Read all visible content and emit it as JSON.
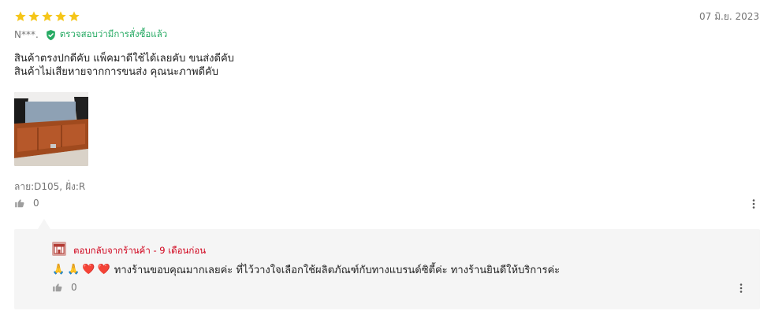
{
  "review": {
    "rating": 5,
    "date": "07 มิ.ย. 2023",
    "user": "N***.",
    "verified_label": "ตรวจสอบว่ามีการสั่งซื้อแล้ว",
    "text_lines": [
      "สินค้าตรงปกดีคับ แพ็คมาดีใช้ได้เลยคับ ขนส่งดีคับ",
      "สินค้าไม่เสียหายจากการขนส่ง คุณนะภาพดีคับ"
    ],
    "variant": "ลาย:D105, ฝั่ง:R",
    "likes": "0"
  },
  "reply": {
    "label": "ตอบกลับจากร้านค้า - 9 เดือนก่อน",
    "emojis": [
      "🙏",
      "🙏",
      "❤️",
      "❤️"
    ],
    "text": "ทางร้านขอบคุณมากเลยค่ะ ที่ไว้วางใจเลือกใช้ผลิตภัณฑ์กับทางแบรนด์ซิตี้ค่ะ ทางร้านยินดีให้บริการค่ะ",
    "likes": "0"
  },
  "colors": {
    "star": "#f5c518",
    "verified": "#26aa63",
    "reply_label": "#d0021b",
    "reply_bg": "#f5f5f5"
  },
  "icons": {
    "star": "star-icon",
    "verified": "check-shield-icon",
    "like": "thumbs-up-icon",
    "more": "more-vertical-icon",
    "shop": "shop-icon"
  }
}
